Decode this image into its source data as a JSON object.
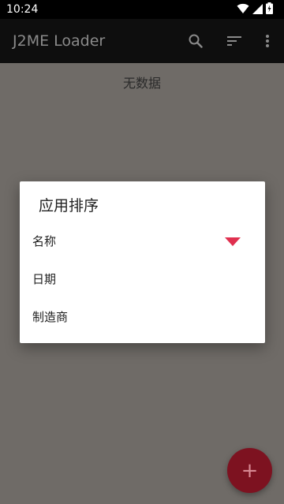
{
  "status_bar": {
    "time": "10:24",
    "icons": [
      "wifi-icon",
      "signal-icon",
      "battery-charging-icon"
    ]
  },
  "app_bar": {
    "title": "J2ME Loader",
    "actions": [
      "search-icon",
      "sort-icon",
      "more-vert-icon"
    ]
  },
  "content": {
    "empty_text": "无数据"
  },
  "sort_dialog": {
    "title": "应用排序",
    "options": [
      {
        "label": "名称",
        "selected": true,
        "direction": "descending"
      },
      {
        "label": "日期",
        "selected": false
      },
      {
        "label": "制造商",
        "selected": false
      }
    ]
  },
  "fab": {
    "icon": "plus-icon",
    "glyph": "+"
  },
  "colors": {
    "accent": "#e0304f",
    "fab": "#7d1220",
    "app_bar": "#0e0e0e",
    "scrim_background": "#6f6b67"
  }
}
